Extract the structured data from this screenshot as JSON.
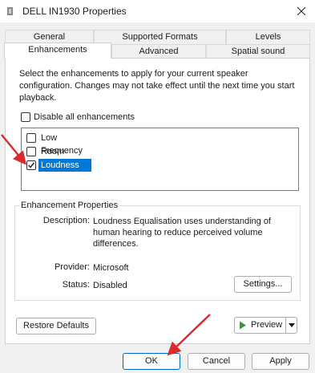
{
  "window": {
    "title": "DELL IN1930 Properties"
  },
  "tabs_row1": [
    {
      "label": "General"
    },
    {
      "label": "Supported Formats"
    },
    {
      "label": "Levels"
    }
  ],
  "tabs_row2": [
    {
      "label": "Enhancements",
      "active": true
    },
    {
      "label": "Advanced"
    },
    {
      "label": "Spatial sound"
    }
  ],
  "enhancements": {
    "description": "Select the enhancements to apply for your current speaker configuration. Changes may not take effect until the next time you start playback.",
    "disable_all_label": "Disable all enhancements",
    "disable_all_checked": false,
    "items": [
      {
        "label": "Low Frequency Protection",
        "checked": false,
        "selected": false
      },
      {
        "label": "Room Correction",
        "checked": false,
        "selected": false
      },
      {
        "label": "Loudness Equalisation",
        "checked": true,
        "selected": true
      }
    ]
  },
  "properties": {
    "group_title": "Enhancement Properties",
    "description_label": "Description:",
    "description_value": "Loudness Equalisation uses understanding of human hearing to reduce perceived volume differences.",
    "provider_label": "Provider:",
    "provider_value": "Microsoft",
    "status_label": "Status:",
    "status_value": "Disabled",
    "settings_label": "Settings..."
  },
  "buttons": {
    "restore_defaults": "Restore Defaults",
    "preview": "Preview",
    "ok": "OK",
    "cancel": "Cancel",
    "apply": "Apply"
  },
  "colors": {
    "selection": "#0078d7",
    "annotation_arrow": "#d92b2b",
    "preview_play": "#2e9e3a"
  }
}
